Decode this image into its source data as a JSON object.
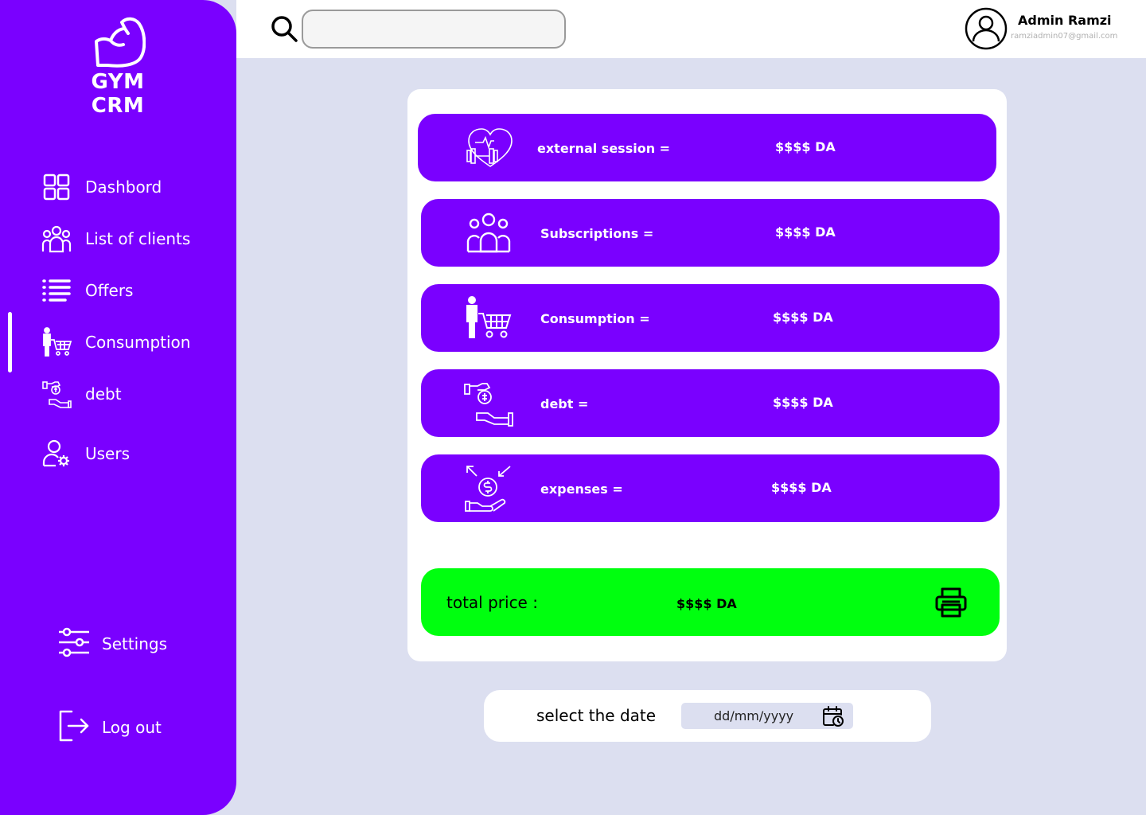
{
  "app": {
    "brand": "GYM CRM"
  },
  "sidebar": {
    "items": [
      {
        "label": "Dashbord",
        "icon": "dashboard-grid-icon"
      },
      {
        "label": "List of clients",
        "icon": "clients-group-icon"
      },
      {
        "label": "Offers",
        "icon": "list-icon"
      },
      {
        "label": "Consumption",
        "icon": "person-cart-icon",
        "active": true
      },
      {
        "label": "debt",
        "icon": "money-hand-icon"
      },
      {
        "label": "Users",
        "icon": "user-gear-icon"
      }
    ],
    "settings_label": "Settings",
    "logout_label": "Log out"
  },
  "header": {
    "search_placeholder": "",
    "user_name": "Admin Ramzi",
    "user_email": "ramziadmin07@gmail.com"
  },
  "stats": [
    {
      "label": "external session =",
      "value": "$$$$ DA",
      "icon": "heart-dumbbell-icon"
    },
    {
      "label": "Subscriptions =",
      "value": "$$$$ DA",
      "icon": "people-group-icon"
    },
    {
      "label": "Consumption =",
      "value": "$$$$ DA",
      "icon": "person-cart-icon"
    },
    {
      "label": "debt =",
      "value": "$$$$ DA",
      "icon": "money-hand-icon"
    },
    {
      "label": "expenses =",
      "value": "$$$$ DA",
      "icon": "coin-hand-arrows-icon"
    }
  ],
  "total": {
    "label": "total price :",
    "value": "$$$$ DA",
    "icon": "printer-icon"
  },
  "date_select": {
    "label": "select the date",
    "placeholder": "dd/mm/yyyy",
    "icon": "calendar-clock-icon"
  },
  "colors": {
    "accent": "#7a00ff",
    "total": "#00ff0f",
    "background": "#dcdff0"
  }
}
